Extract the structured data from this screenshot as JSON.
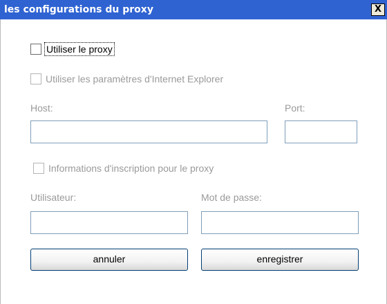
{
  "window": {
    "title": "les configurations du proxy",
    "close_label": "X"
  },
  "options": {
    "use_proxy": {
      "label": "Utiliser le proxy",
      "checked": false,
      "enabled": true
    },
    "use_ie_settings": {
      "label": "Utiliser les paramètres d'Internet Explorer",
      "checked": false,
      "enabled": false
    },
    "proxy_credentials": {
      "label": "Informations d'inscription pour le proxy",
      "checked": false,
      "enabled": false
    }
  },
  "fields": {
    "host": {
      "label": "Host:",
      "value": ""
    },
    "port": {
      "label": "Port:",
      "value": ""
    },
    "user": {
      "label": "Utilisateur:",
      "value": ""
    },
    "password": {
      "label": "Mot de passe:",
      "value": ""
    }
  },
  "buttons": {
    "cancel": "annuler",
    "save": "enregistrer"
  },
  "colors": {
    "titlebar": "#2f63d2",
    "disabled_text": "#9a9a9a"
  }
}
